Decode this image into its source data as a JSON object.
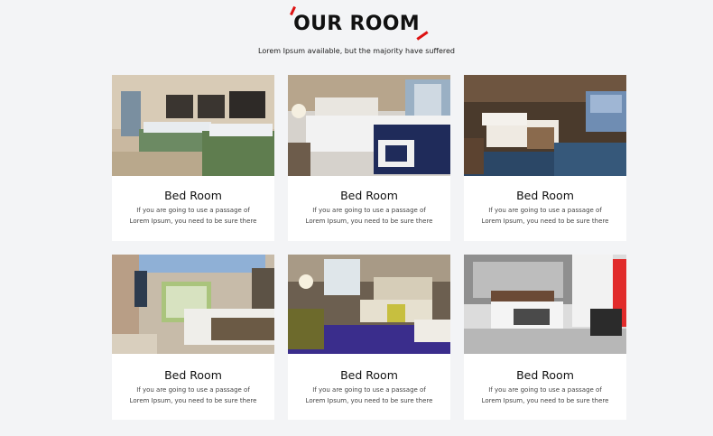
{
  "section": {
    "title": "OUR ROOM",
    "subtitle": "Lorem Ipsum available, but the majority have suffered"
  },
  "colors": {
    "accent": "#dd1111",
    "background": "#f3f4f6",
    "card": "#ffffff"
  },
  "rooms": [
    {
      "name": "Bed Room",
      "desc_line1": "If you are going to use a passage of",
      "desc_line2": "Lorem Ipsum, you need to be sure there"
    },
    {
      "name": "Bed Room",
      "desc_line1": "If you are going to use a passage of",
      "desc_line2": "Lorem Ipsum, you need to be sure there"
    },
    {
      "name": "Bed Room",
      "desc_line1": "If you are going to use a passage of",
      "desc_line2": "Lorem Ipsum, you need to be sure there"
    },
    {
      "name": "Bed Room",
      "desc_line1": "If you are going to use a passage of",
      "desc_line2": "Lorem Ipsum, you need to be sure there"
    },
    {
      "name": "Bed Room",
      "desc_line1": "If you are going to use a passage of",
      "desc_line2": "Lorem Ipsum, you need to be sure there"
    },
    {
      "name": "Bed Room",
      "desc_line1": "If you are going to use a passage of",
      "desc_line2": "Lorem Ipsum, you need to be sure there"
    }
  ]
}
